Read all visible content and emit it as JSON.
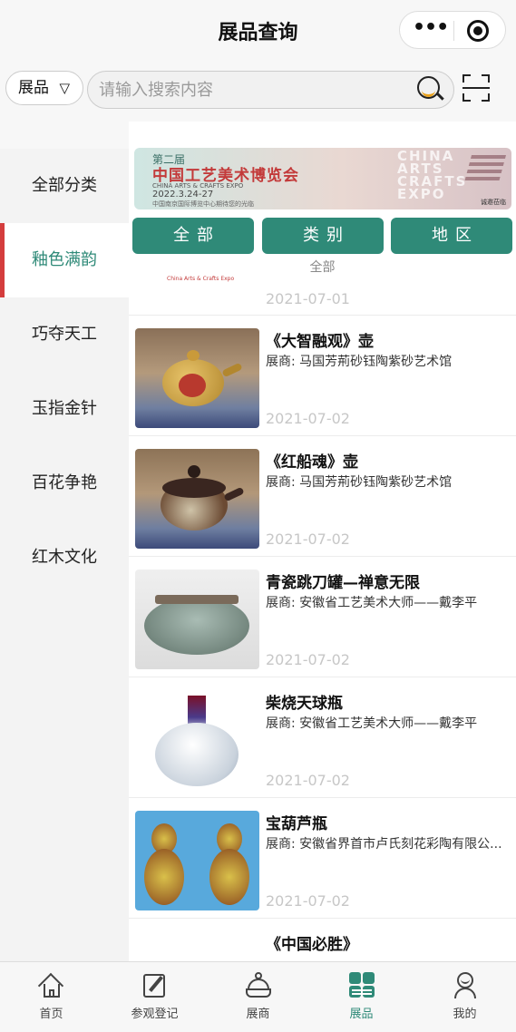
{
  "titlebar": {
    "title": "展品查询",
    "more_glyph": "•••"
  },
  "search": {
    "type_label": "展品",
    "type_caret": "▽",
    "placeholder": "请输入搜索内容",
    "value": ""
  },
  "sidebar": {
    "items": [
      {
        "label": "全部分类",
        "active": false
      },
      {
        "label": "釉色满韵",
        "active": true
      },
      {
        "label": "巧夺天工",
        "active": false
      },
      {
        "label": "玉指金针",
        "active": false
      },
      {
        "label": "百花争艳",
        "active": false
      },
      {
        "label": "红木文化",
        "active": false
      }
    ]
  },
  "banner": {
    "line1": "第二届",
    "line2": "中国工艺美术博览会",
    "line3": "CHINA ARTS & CRAFTS EXPO",
    "line4": "2022.3.24-27",
    "line5": "中国南京国际博览中心期待您的光临",
    "line6": "CHINA ARTS CRAFTS EXPO",
    "line7": "诚邀莅临"
  },
  "tabs": [
    "全部",
    "类别",
    "地区"
  ],
  "filter_label": "全部",
  "first_item": {
    "logo_text": "China Arts & Crafts Expo",
    "date": "2021-07-01"
  },
  "items": [
    {
      "name": "《大智融观》壶",
      "seller": "展商: 马国芳荊砂钰陶紫砂艺术馆",
      "date": "2021-07-02"
    },
    {
      "name": "《红船魂》壶",
      "seller": "展商: 马国芳荊砂钰陶紫砂艺术馆",
      "date": "2021-07-02"
    },
    {
      "name": "青瓷跳刀罐—禅意无限",
      "seller": "展商: 安徽省工艺美术大师——戴李平",
      "date": "2021-07-02"
    },
    {
      "name": "柴烧天球瓶",
      "seller": "展商: 安徽省工艺美术大师——戴李平",
      "date": "2021-07-02"
    },
    {
      "name": "宝葫芦瓶",
      "seller": "展商: 安徽省界首市卢氏刻花彩陶有限公...",
      "date": "2021-07-02"
    },
    {
      "name": "《中国必胜》",
      "seller": "",
      "date": ""
    }
  ],
  "tabbar": [
    {
      "label": "首页",
      "icon": "home-icon",
      "active": false
    },
    {
      "label": "参观登记",
      "icon": "register-icon",
      "active": false
    },
    {
      "label": "展商",
      "icon": "exhibitor-icon",
      "active": false
    },
    {
      "label": "展品",
      "icon": "products-icon",
      "active": true
    },
    {
      "label": "我的",
      "icon": "profile-icon",
      "active": false
    }
  ],
  "colors": {
    "accent": "#2f8a78",
    "active_marker": "#d43d3d"
  }
}
